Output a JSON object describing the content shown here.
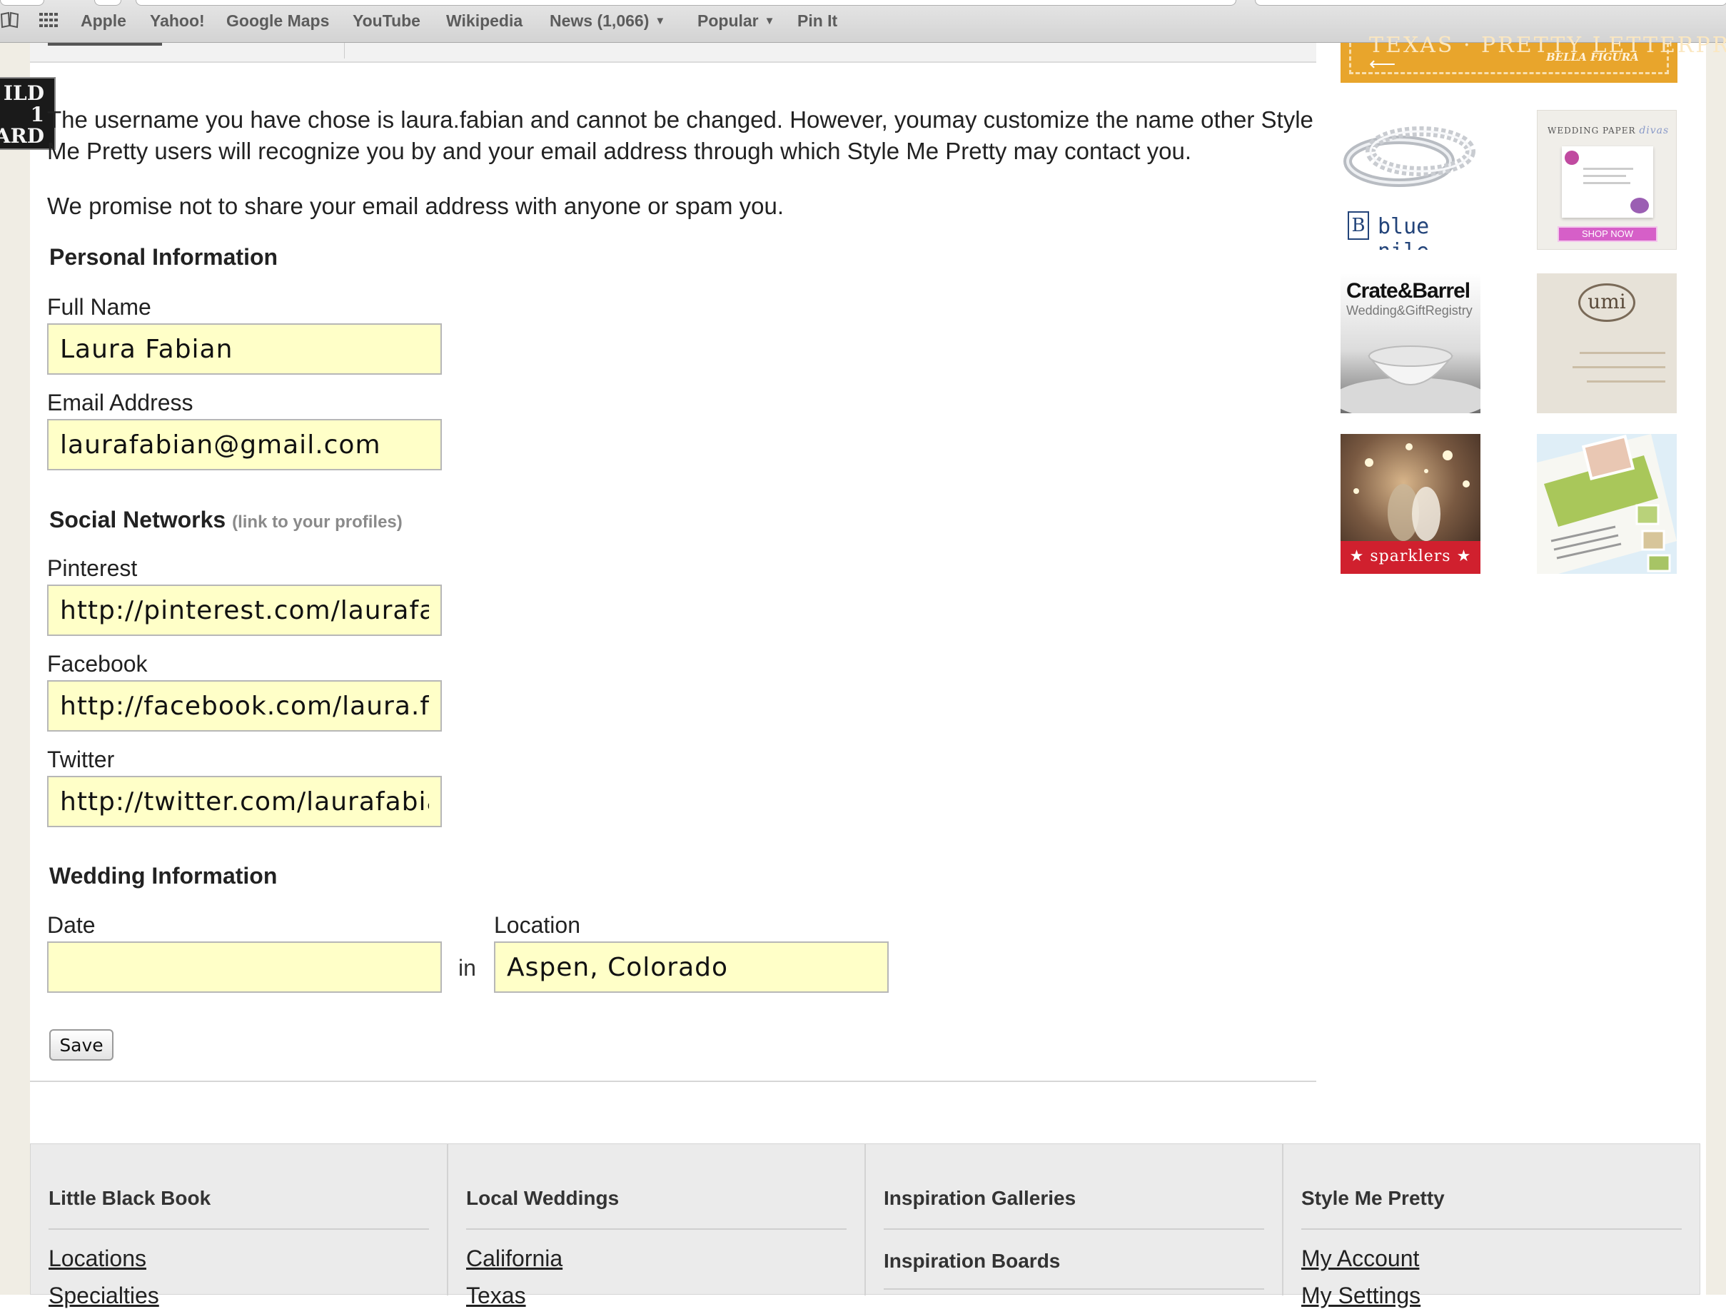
{
  "bookmarks": {
    "items": [
      {
        "label": "Apple"
      },
      {
        "label": "Yahoo!"
      },
      {
        "label": "Google Maps"
      },
      {
        "label": "YouTube"
      },
      {
        "label": "Wikipedia"
      },
      {
        "label": "News (1,066)",
        "has_menu": true
      },
      {
        "label": "Popular",
        "has_menu": true
      },
      {
        "label": "Pin It"
      }
    ],
    "icons": [
      "open-book-icon",
      "grid-icon"
    ]
  },
  "badge": {
    "lines": [
      "ILD",
      "1",
      "ARD"
    ]
  },
  "intro": {
    "line1": "The username you have chose is laura.fabian and cannot be changed. However, youmay customize the name other Style",
    "line2": "Me Pretty users will recognize you by and your email address through which Style Me Pretty may contact you.",
    "promise": "We promise not to share your email address with anyone or spam you."
  },
  "personal": {
    "heading": "Personal Information",
    "full_name_label": "Full Name",
    "full_name": "Laura Fabian",
    "email_label": "Email Address",
    "email": "laurafabian@gmail.com"
  },
  "social": {
    "heading": "Social Networks",
    "hint": "(link to your profiles)",
    "pinterest_label": "Pinterest",
    "pinterest": "http://pinterest.com/laurafabian",
    "facebook_label": "Facebook",
    "facebook": "http://facebook.com/laura.fabian",
    "twitter_label": "Twitter",
    "twitter": "http://twitter.com/laurafabian"
  },
  "wedding": {
    "heading": "Wedding Information",
    "date_label": "Date",
    "date": "",
    "in_label": "in",
    "location_label": "Location",
    "location": "Aspen, Colorado"
  },
  "actions": {
    "save": "Save"
  },
  "ads": {
    "banner_top": "TEXAS · PRETTY LETTERPRESS",
    "banner_sub": "BELLA FIGURA",
    "bluenile": "blue nile.",
    "wedding_paper": "WEDDING PAPER",
    "wedding_paper_brand": "divas",
    "wedding_paper_cta": "SHOP NOW",
    "crate_title": "Crate&Barrel",
    "crate_sub": "Wedding&GiftRegistry",
    "umi": "umi",
    "sparklers": "sparklers"
  },
  "footer": {
    "columns": [
      {
        "heading": "Little Black Book",
        "link": "Locations",
        "next": "Specialties"
      },
      {
        "heading": "Local Weddings",
        "link": "California",
        "next": "Texas"
      },
      {
        "heading": "Inspiration Galleries",
        "link": "Inspiration Boards"
      },
      {
        "heading": "Style Me Pretty",
        "link": "My Account",
        "next": "My Settings"
      }
    ]
  },
  "colors": {
    "input_bg": "#ffffc8",
    "banner_orange": "#e8a52c",
    "footer_bg": "#ebebeb",
    "sparklers_red": "#d0202e"
  }
}
